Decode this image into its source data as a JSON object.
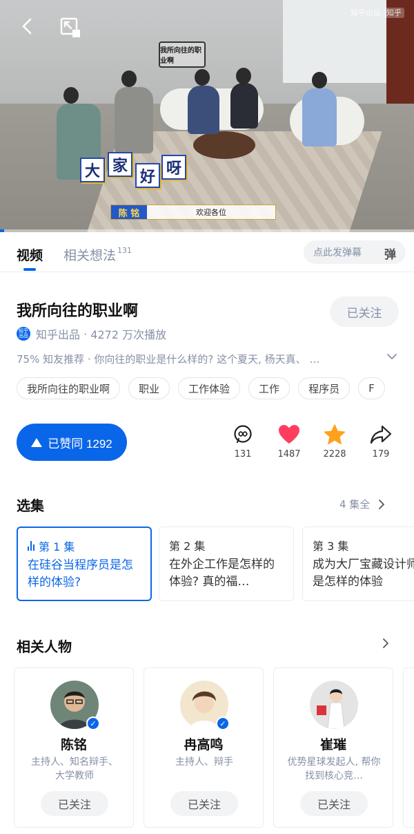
{
  "video": {
    "watermark_text": "知乎出品",
    "watermark_badge": "知乎",
    "show_logo": "我所向往的职业啊",
    "greeting_chars": [
      "大",
      "家",
      "好",
      "呀"
    ],
    "nameplate_name": "陈 铭",
    "nameplate_caption": "欢迎各位",
    "progress": 0.01
  },
  "tabs": {
    "video_label": "视频",
    "ideas_label": "相关想法",
    "ideas_count": "131",
    "danmaku_placeholder": "点此发弹幕",
    "danmaku_button": "弹"
  },
  "header": {
    "title": "我所向往的职业啊",
    "follow_label": "已关注",
    "logo_text": "知乎出品",
    "source": "知乎出品",
    "plays": "4272 万次播放",
    "description": "75% 知友推荐 · 你向往的职业是什么样的? 这个夏天, 杨天真、 …"
  },
  "tags": [
    "我所向往的职业啊",
    "职业",
    "工作体验",
    "工作",
    "程序员",
    "F"
  ],
  "actions": {
    "agree_label": "已赞同 1292",
    "comments": "131",
    "likes": "1487",
    "favorites": "2228",
    "shares": "179"
  },
  "episodes_section": {
    "title": "选集",
    "more": "4 集全",
    "items": [
      {
        "no": "第 1 集",
        "title": "在硅谷当程序员是怎样的体验?"
      },
      {
        "no": "第 2 集",
        "title": "在外企工作是怎样的体验? 真的福…"
      },
      {
        "no": "第 3 集",
        "title": "成为大厂宝藏设计师是怎样的体验"
      }
    ]
  },
  "people_section": {
    "title": "相关人物",
    "items": [
      {
        "name": "陈铭",
        "desc": "主持人、知名辩手、大学教师",
        "follow": "已关注"
      },
      {
        "name": "冉高鸣",
        "desc": "主持人、辩手",
        "follow": "已关注"
      },
      {
        "name": "崔璀",
        "desc": "优势星球发起人, 帮你找到核心竞…",
        "follow": "已关注"
      }
    ]
  },
  "colors": {
    "accent": "#0a66e8",
    "like_red": "#ff3d5f",
    "favorite_orange": "#ffa11c",
    "muted": "#8590a6"
  }
}
